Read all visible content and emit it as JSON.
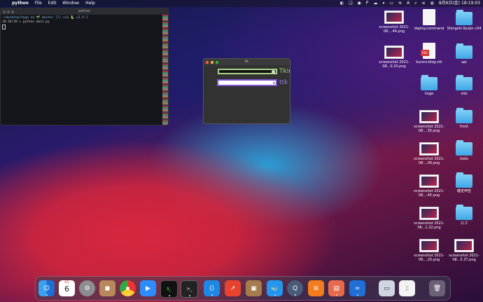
{
  "menubar": {
    "app": "python",
    "items": [
      "File",
      "Edit",
      "Window",
      "Help"
    ],
    "status_text": "A",
    "clock": "8月6日(金)  18:19:03"
  },
  "terminal": {
    "title": "python",
    "lines": [
      "~/desktop/hoge on 🌱 master [?] via 🐍 v3.9.1",
      "18:18:58 > python main.py",
      ""
    ]
  },
  "tk_window": {
    "title": "tk",
    "label_tkinter": "Tkinter",
    "label_ttk": "ttk"
  },
  "desktop_icons": [
    {
      "label": "screenshot 2021-08....44.png",
      "type": "shot"
    },
    {
      "label": "deploy.command",
      "type": "doc"
    },
    {
      "label": "Shingeki Kyojin v34",
      "type": "folder"
    },
    {
      "label": "screenshot 2021-08...0.10.png",
      "type": "shot"
    },
    {
      "label": "kuroro.blog.stk",
      "type": "pdf"
    },
    {
      "label": "api",
      "type": "folder"
    },
    {
      "label": "hoge",
      "type": "folder"
    },
    {
      "label": "site",
      "type": "folder"
    },
    {
      "label": "screenshot 2021-08....35.png",
      "type": "shot"
    },
    {
      "label": "front",
      "type": "folder"
    },
    {
      "label": "screenshot 2021-08....09.png",
      "type": "shot"
    },
    {
      "label": "tools",
      "type": "folder"
    },
    {
      "label": "screenshot 2021-08....45.png",
      "type": "shot"
    },
    {
      "label": "確定申告",
      "type": "folder"
    },
    {
      "label": "screenshot 2021-08...1.32.png",
      "type": "shot"
    },
    {
      "label": "ロゴ",
      "type": "folder"
    },
    {
      "label": "screenshot 2021-08....20.png",
      "type": "shot"
    },
    {
      "label": "screenshot 2021-08...5.37.png",
      "type": "shot"
    }
  ],
  "dock": {
    "calendar_month": "8月",
    "calendar_day": "6",
    "apps": [
      "finder-icon",
      "calendar-icon",
      "system-preferences-icon",
      "contacts-icon",
      "chrome-icon",
      "zoom-icon",
      "iterm-icon",
      "terminal-icon",
      "vscode-icon",
      "activity-icon",
      "archive-icon",
      "docker-icon",
      "quicktime-icon",
      "sourcetree-icon",
      "preview-icon",
      "infinity-icon",
      "screenshot-icon",
      "document-icon",
      "trash-icon"
    ]
  }
}
